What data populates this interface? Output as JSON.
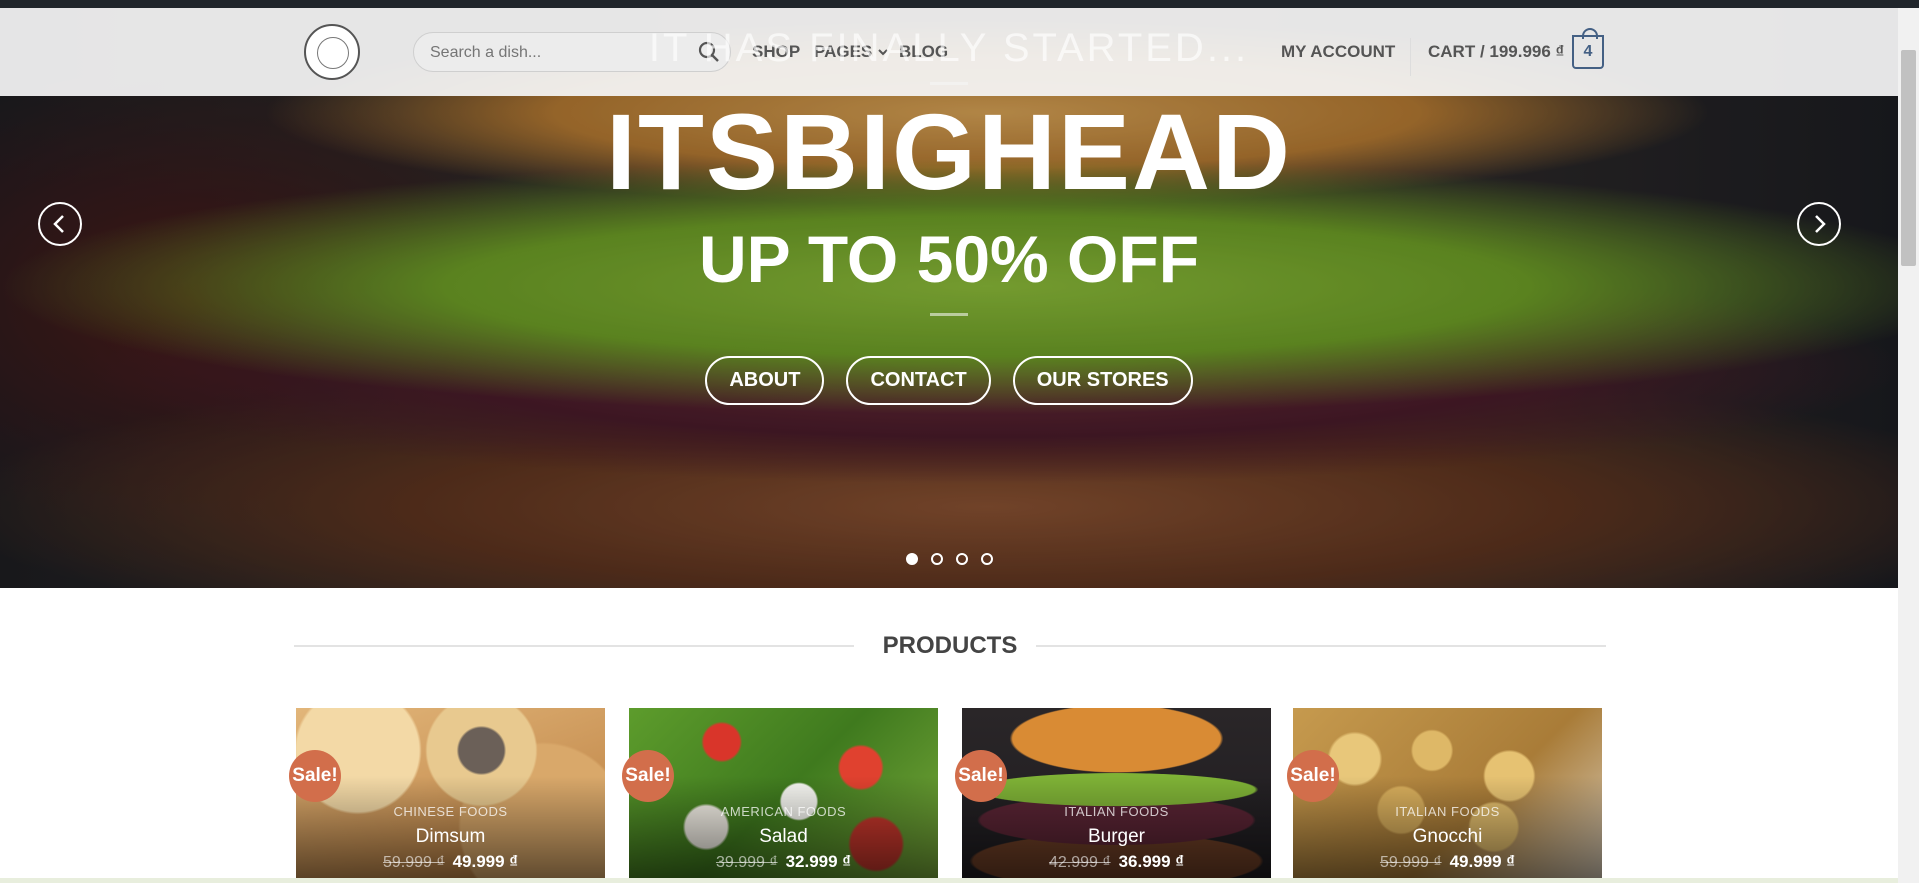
{
  "header": {
    "search_placeholder": "Search a dish...",
    "nav": {
      "shop": "SHOP",
      "pages": "PAGES",
      "blog": "BLOG"
    },
    "my_account": "MY ACCOUNT",
    "cart_label": "CART / 199.996 ₫",
    "cart_count": "4"
  },
  "hero": {
    "kicker": "IT HAS FINALLY STARTED...",
    "title": "ITSBIGHEAD",
    "subtitle": "UP TO 50% OFF",
    "buttons": [
      "ABOUT",
      "CONTACT",
      "OUR STORES"
    ],
    "slide_count": 4,
    "active_slide": 1
  },
  "products_section": {
    "title": "PRODUCTS",
    "items": [
      {
        "sale": "Sale!",
        "category": "CHINESE FOODS",
        "name": "Dimsum",
        "old_price": "59.999 ₫",
        "price": "49.999 ₫"
      },
      {
        "sale": "Sale!",
        "category": "AMERICAN FOODS",
        "name": "Salad",
        "old_price": "39.999 ₫",
        "price": "32.999 ₫"
      },
      {
        "sale": "Sale!",
        "category": "ITALIAN FOODS",
        "name": "Burger",
        "old_price": "42.999 ₫",
        "price": "36.999 ₫"
      },
      {
        "sale": "Sale!",
        "category": "ITALIAN FOODS",
        "name": "Gnocchi",
        "old_price": "59.999 ₫",
        "price": "49.999 ₫"
      }
    ]
  },
  "colors": {
    "accent": "#446084",
    "sale_badge": "#d26e4b"
  }
}
